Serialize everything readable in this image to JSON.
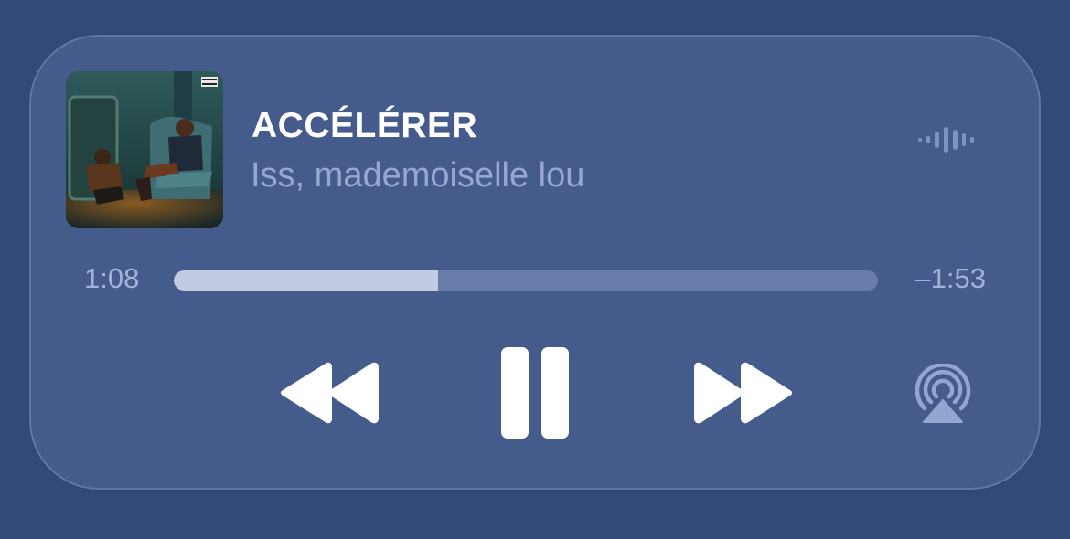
{
  "now_playing": {
    "title": "ACCÉLÉRER",
    "artist": "Iss, mademoiselle lou",
    "elapsed": "1:08",
    "remaining": "–1:53",
    "progress_fraction": 0.375,
    "artwork_badge": "PARENTAL ADVISORY"
  },
  "icons": {
    "wave": "audio-waveform-icon",
    "rewind": "rewind-icon",
    "pause": "pause-icon",
    "forward": "fast-forward-icon",
    "airplay": "airplay-icon"
  },
  "colors": {
    "background": "#334a78",
    "card": "#445b8c",
    "title": "#ffffff",
    "artist": "#97a8cf",
    "progress_fill": "#c2cbe2",
    "progress_track": "#677ca9"
  }
}
